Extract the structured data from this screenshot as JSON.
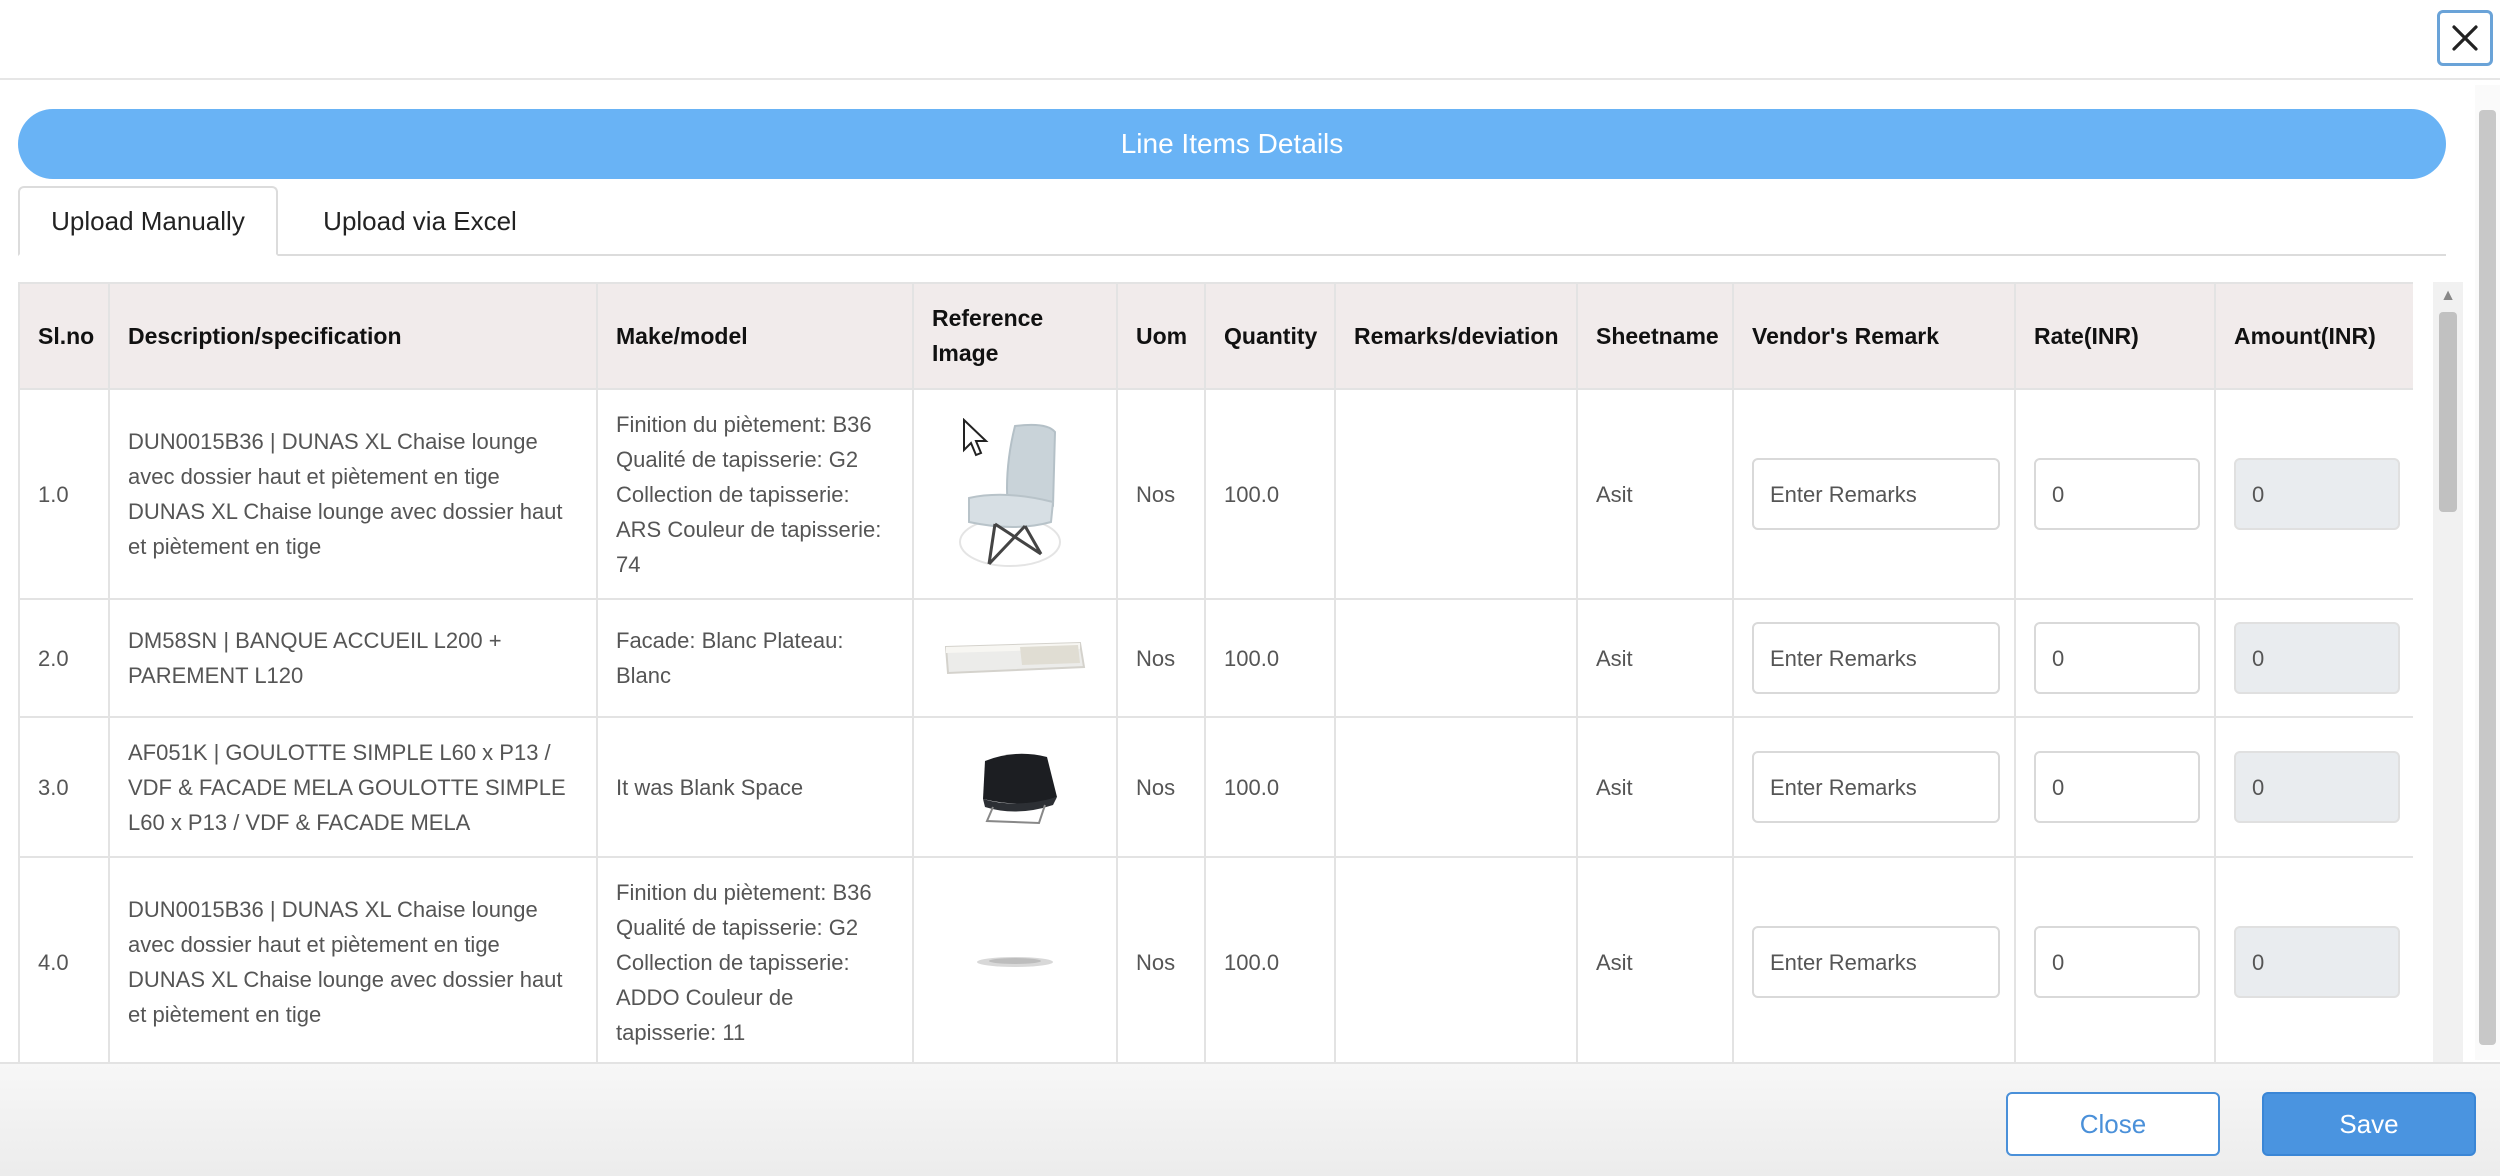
{
  "dialog": {
    "close_icon": "close-icon"
  },
  "banner": {
    "title": "Line Items Details"
  },
  "tabs": [
    {
      "label": "Upload Manually",
      "active": true
    },
    {
      "label": "Upload via Excel",
      "active": false
    }
  ],
  "table": {
    "headers": {
      "slno": "Sl.no",
      "description": "Description/specification",
      "make": "Make/model",
      "refimg_line1": "Reference",
      "refimg_line2": "Image",
      "uom": "Uom",
      "quantity": "Quantity",
      "remarks": "Remarks/deviation",
      "sheetname": "Sheetname",
      "vendor_remark": "Vendor's Remark",
      "rate": "Rate(INR)",
      "amount": "Amount(INR)"
    },
    "rows": [
      {
        "slno": "1.0",
        "description": "DUN0015B36 | DUNAS XL Chaise lounge avec dossier haut et piètement en tige DUNAS XL Chaise lounge avec dossier haut et piètement en tige",
        "make": "Finition du piètement: B36 Qualité de tapisserie: G2 Collection de tapisserie: ARS Couleur de tapisserie: 74",
        "image": "lounge-chair-image",
        "uom": "Nos",
        "quantity": "100.0",
        "remarks": "",
        "sheetname": "Asit",
        "vendor_placeholder": "Enter Remarks",
        "rate": "0",
        "amount": "0"
      },
      {
        "slno": "2.0",
        "description": "DM58SN | BANQUE ACCUEIL L200 + PAREMENT L120",
        "make": "Facade: Blanc Plateau: Blanc",
        "image": "reception-desk-image",
        "uom": "Nos",
        "quantity": "100.0",
        "remarks": "",
        "sheetname": "Asit",
        "vendor_placeholder": "Enter Remarks",
        "rate": "0",
        "amount": "0"
      },
      {
        "slno": "3.0",
        "description": "AF051K | GOULOTTE SIMPLE L60 x P13 / VDF & FACADE MELA GOULOTTE SIMPLE L60 x P13 / VDF & FACADE MELA",
        "make": "It was Blank Space",
        "image": "black-chair-image",
        "uom": "Nos",
        "quantity": "100.0",
        "remarks": "",
        "sheetname": "Asit",
        "vendor_placeholder": "Enter Remarks",
        "rate": "0",
        "amount": "0"
      },
      {
        "slno": "4.0",
        "description": "DUN0015B36 | DUNAS XL Chaise lounge avec dossier haut et piètement en tige DUNAS XL Chaise lounge avec dossier haut et piètement en tige",
        "make": "Finition du piètement: B36 Qualité de tapisserie: G2 Collection de tapisserie: ADDO Couleur de tapisserie: 11",
        "image": "fabric-swatch-image",
        "uom": "Nos",
        "quantity": "100.0",
        "remarks": "",
        "sheetname": "Asit",
        "vendor_placeholder": "Enter Remarks",
        "rate": "0",
        "amount": "0"
      }
    ]
  },
  "footer": {
    "close_label": "Close",
    "save_label": "Save"
  },
  "colors": {
    "banner": "#69b3f5",
    "header_bg": "#f1ebeb",
    "save_bg": "#4a94e0",
    "close_border": "#4a90d9"
  }
}
